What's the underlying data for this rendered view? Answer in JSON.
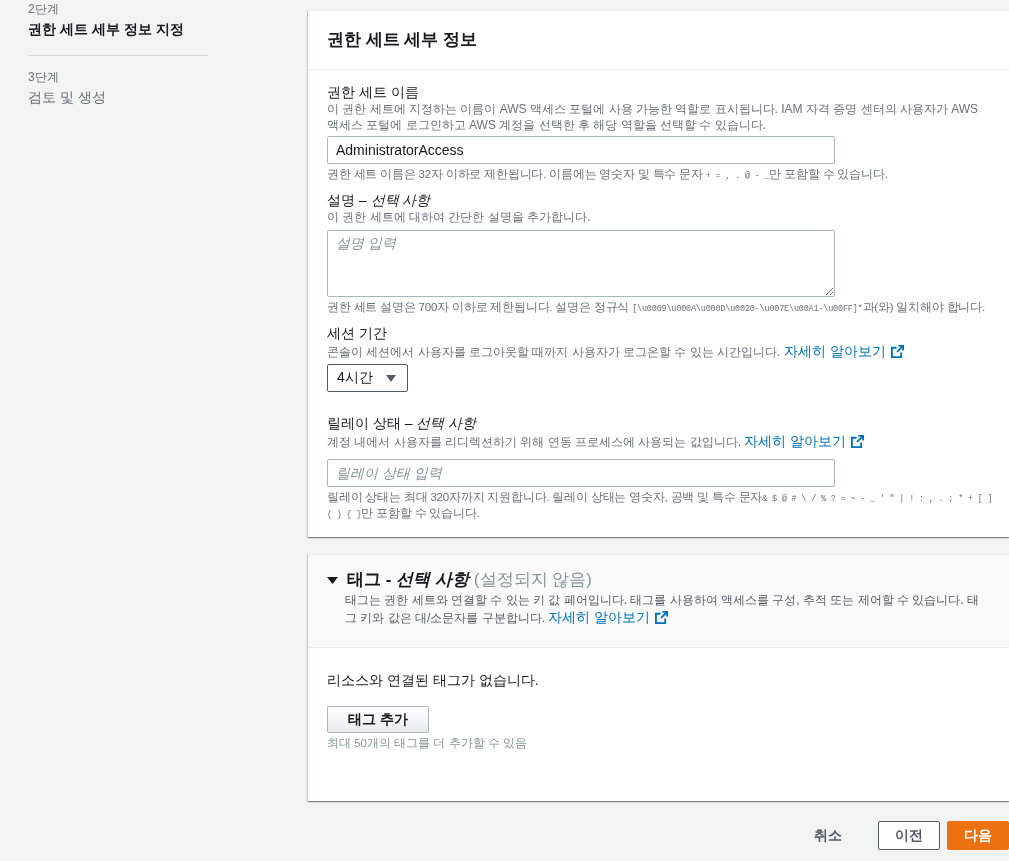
{
  "steps": [
    {
      "step": "2단계",
      "title": "권한 세트 세부 정보 지정",
      "selected": true
    },
    {
      "step": "3단계",
      "title": "검토 및 생성",
      "selected": false
    }
  ],
  "details": {
    "title": "권한 세트 세부 정보",
    "fields": [
      {
        "kind": "input",
        "label": "권한 세트 이름",
        "description": "이 권한 세트에 지정하는 이름이 AWS 액세스 포털에 사용 가능한 역할로 표시됩니다. IAM 자격 증명 센터의 사용자가 AWS 액세스 포털에 로그인하고 AWS 계정을 선택한 후 해당 역할을 선택할 수 있습니다.",
        "value": "AdministratorAccess",
        "constraint": [
          {
            "kind": "text",
            "text": "권한 세트 이름은 32자 이하로 제한됩니다. 이름에는 영숫자 및 특수 문자 "
          },
          {
            "kind": "code",
            "text": "+ = , . @ - _"
          },
          {
            "kind": "text",
            "text": "만 포함할 수 있습니다."
          }
        ]
      },
      {
        "kind": "textarea",
        "label": "설명 – *선택 사항*",
        "description": "이 권한 세트에 대하여 간단한 설명을 추가합니다.",
        "placeholder": "설명 입력",
        "constraint": [
          {
            "kind": "text",
            "text": "권한 세트 설명은 700자 이하로 제한됩니다. 설명은 정규식 "
          },
          {
            "kind": "code",
            "text": "[\\u0009\\u000A\\u000D\\u0020-\\u007E\\u00A1-\\u00FF]*"
          },
          {
            "kind": "text",
            "text": "과(와) 일치해야 합니다."
          }
        ]
      },
      {
        "kind": "select",
        "label": "세션 기간",
        "description": "콘솔이 세션에서 사용자를 로그아웃할 때까지 사용자가 로그온할 수 있는 시간입니다.",
        "link": "자세히 알아보기",
        "value": "4시간"
      },
      {
        "kind": "input",
        "label": "릴레이 상태 – *선택 사항*",
        "description": "계정 내에서 사용자를 리디렉션하기 위해 연동 프로세스에 사용되는 값입니다.",
        "link": "자세히 알아보기",
        "placeholder": "릴레이 상태 입력",
        "constraint": [
          {
            "kind": "text",
            "text": "릴레이 상태는 최대 320자까지 지원합니다. 릴레이 상태는 영숫자, 공백 및 특수 문자"
          },
          {
            "kind": "code",
            "text": "& $ @ # \\ / % ? = ~ - _ ' \" | ! : , . ; * + [ ] ( ) { }"
          },
          {
            "kind": "text",
            "text": "만 포함할 수 있습니다."
          }
        ]
      }
    ]
  },
  "tags": {
    "expanded": true,
    "title": "태그 - *선택 사항*",
    "status": "(설정되지 않음)",
    "description": "태그는 권한 세트와 연결할 수 있는 키 값 페어입니다. 태그를 사용하여 액세스를 구성, 추적 또는 제어할 수 있습니다. 태그 키와 값은 대/소문자를 구분합니다.",
    "link": "자세히 알아보기",
    "empty_message": "리소스와 연결된 태그가 없습니다.",
    "add_button": "태그 추가",
    "limit_hint": "최대 50개의 태그를 더 추가할 수 있음"
  },
  "actions": [
    {
      "kind": "link",
      "label": "취소"
    },
    {
      "kind": "normal",
      "label": "이전"
    },
    {
      "kind": "primary",
      "label": "다음"
    }
  ]
}
